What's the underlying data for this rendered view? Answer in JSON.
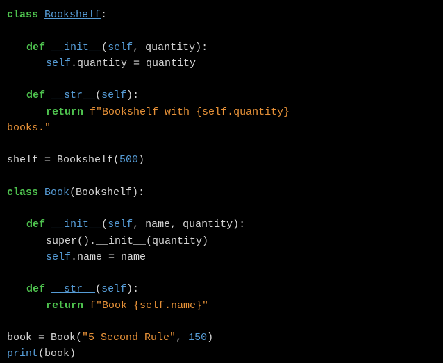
{
  "code": {
    "line1": {
      "class_kw": "class",
      "class_name": "Bookshelf",
      "colon": ":"
    },
    "line3": {
      "def_kw": "def",
      "method_name": "__init__",
      "open_paren": "(",
      "self": "self",
      "comma": ", ",
      "param": "quantity",
      "close": "):"
    },
    "line4": {
      "self": "self",
      "dot_attr": ".quantity = quantity"
    },
    "line6": {
      "def_kw": "def",
      "method_name": "__str__",
      "open_paren": "(",
      "self": "self",
      "close": "):"
    },
    "line7": {
      "return_kw": "return",
      "space": " ",
      "fstring": "f\"Bookshelf with {self.quantity}"
    },
    "line8": {
      "fstring_cont": "books.\""
    },
    "line10": {
      "var": "shelf = Bookshelf(",
      "num": "500",
      "close": ")"
    },
    "line12": {
      "class_kw": "class",
      "class_name": "Book",
      "parent": "(Bookshelf):"
    },
    "line14": {
      "def_kw": "def",
      "method_name": "__init__",
      "open_paren": "(",
      "self": "self",
      "params": ", name, quantity):"
    },
    "line15": {
      "super_call": "super().__init__(quantity)"
    },
    "line16": {
      "self": "self",
      "dot_attr": ".name = name"
    },
    "line18": {
      "def_kw": "def",
      "method_name": "__str__",
      "open_paren": "(",
      "self": "self",
      "close": "):"
    },
    "line19": {
      "return_kw": "return",
      "space": " ",
      "fstring": "f\"Book {self.name}\""
    },
    "line21": {
      "var": "book = Book(",
      "str": "\"5 Second Rule\"",
      "comma": ", ",
      "num": "150",
      "close": ")"
    },
    "line22": {
      "print_fn": "print",
      "args": "(book)"
    }
  }
}
